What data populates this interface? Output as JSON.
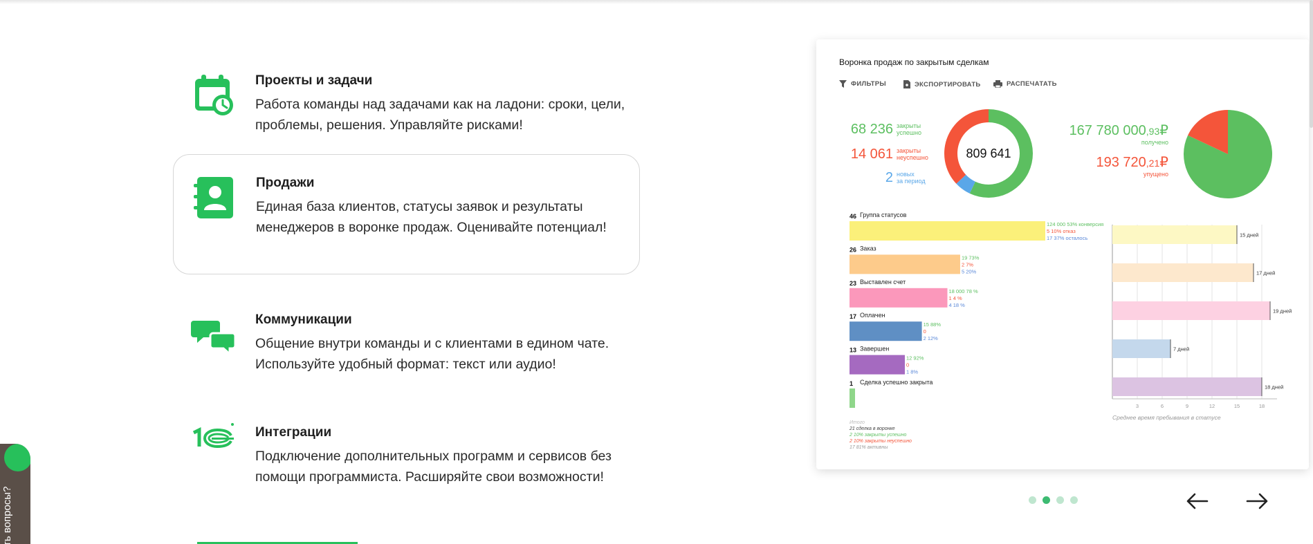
{
  "features": [
    {
      "title": "Проекты и задачи",
      "desc": "Работа команды над задачами как на ладони: сроки, цели, проблемы, решения. Управляйте рисками!",
      "icon": "calendar-clock-icon"
    },
    {
      "title": "Продажи",
      "desc": "Единая база клиентов, статусы заявок и результаты менеджеров в воронке продаж. Оценивайте потенциал!",
      "icon": "contact-book-icon"
    },
    {
      "title": "Коммуникации",
      "desc": "Общение внутри команды и с клиентами в едином чате. Используйте удобный формат: текст или аудио!",
      "icon": "chat-bubbles-icon"
    },
    {
      "title": "Интеграции",
      "desc": "Подключение дополнительных программ и сервисов без помощи программиста. Расширяйте свои возможности!",
      "icon": "1c-logo-icon"
    }
  ],
  "panel": {
    "title": "Воронка продаж по закрытым сделкам",
    "tools": [
      "ФИЛЬТРЫ",
      "ЭКСПОРТИРОВАТЬ",
      "РАСПЕЧАТАТЬ"
    ]
  },
  "help": {
    "label": "ть вопросы?"
  },
  "colors": {
    "accent": "#27c05b",
    "green": "#5cbf60",
    "red": "#f4553a",
    "blue": "#5aa7e8",
    "dot": "#bfe6cf",
    "dot_active": "#3dbb72"
  },
  "chart_data": [
    {
      "type": "pie",
      "title": "",
      "center_label": "809 641",
      "legend": [
        {
          "value": "68 236",
          "label1": "закрыты",
          "label2": "успешно",
          "color": "#5cbf60"
        },
        {
          "value": "14 061",
          "label1": "закрыты",
          "label2": "неуспешно",
          "color": "#f4553a"
        },
        {
          "value": "2",
          "label1": "новых",
          "label2": "за период",
          "color": "#5aa7e8"
        }
      ],
      "slices": [
        {
          "name": "закрыты успешно",
          "value": 0.57,
          "color": "#5cbf60"
        },
        {
          "name": "новых",
          "value": 0.06,
          "color": "#5aa7e8"
        },
        {
          "name": "закрыты неуспешно",
          "value": 0.37,
          "color": "#f4553a"
        }
      ]
    },
    {
      "type": "pie",
      "title": "",
      "legend": [
        {
          "value": "167 780 000",
          "cents": ",93",
          "currency": "₽",
          "label": "получено",
          "color": "#5cbf60"
        },
        {
          "value": "193 720",
          "cents": ",21",
          "currency": "₽",
          "label": "упущено",
          "color": "#f4553a"
        }
      ],
      "slices": [
        {
          "name": "получено",
          "value": 0.82,
          "color": "#5cbf60"
        },
        {
          "name": "упущено",
          "value": 0.18,
          "color": "#f4553a"
        }
      ]
    },
    {
      "type": "bar",
      "title": "",
      "categories": [
        "Группа статусов",
        "Заказ",
        "Выставлен счет",
        "Оплачен",
        "Завершен",
        "Сделка успешно закрыта"
      ],
      "counts": [
        "46",
        "26",
        "23",
        "17",
        "13",
        "1"
      ],
      "values": [
        46,
        26,
        23,
        17,
        13,
        1
      ],
      "colors": [
        "#fbf07a",
        "#fdcb8b",
        "#fb98bb",
        "#5f8fc4",
        "#a56ac0",
        "#8fd68a"
      ],
      "annotations": [
        [
          {
            "t": "124 000 53% конверсия",
            "c": "#5cbf60"
          },
          {
            "t": "5 10% отказ",
            "c": "#f4553a"
          },
          {
            "t": "17 37% осталось",
            "c": "#5a88d8"
          }
        ],
        [
          {
            "t": "19 73%",
            "c": "#5cbf60"
          },
          {
            "t": "2 7%",
            "c": "#f4553a"
          },
          {
            "t": "5 20%",
            "c": "#5a88d8"
          }
        ],
        [
          {
            "t": "18 000 78 %",
            "c": "#5cbf60"
          },
          {
            "t": "1 4 %",
            "c": "#f4553a"
          },
          {
            "t": "4 18 %",
            "c": "#5a88d8"
          }
        ],
        [
          {
            "t": "15 88%",
            "c": "#5cbf60"
          },
          {
            "t": "0",
            "c": "#f4553a"
          },
          {
            "t": "2 12%",
            "c": "#5a88d8"
          }
        ],
        [
          {
            "t": "12 92%",
            "c": "#5cbf60"
          },
          {
            "t": "0",
            "c": "#f4553a"
          },
          {
            "t": "1 8%",
            "c": "#5a88d8"
          }
        ],
        []
      ],
      "summary": [
        {
          "t": "Итого",
          "c": "#bbbbbb"
        },
        {
          "t": "21 сделка в воронке",
          "c": "#444444"
        },
        {
          "t": "2 10% закрыты успешно",
          "c": "#5cbf60"
        },
        {
          "t": "2 10% закрыты неуспешно",
          "c": "#f4553a"
        },
        {
          "t": "17 81% активны",
          "c": "#999999"
        }
      ]
    },
    {
      "type": "bar",
      "title": "",
      "xlabel": "Среднее время пребывания в статусе",
      "values": [
        15,
        17,
        19,
        7,
        18
      ],
      "labels": [
        "15 дней",
        "17 дней",
        "19 дней",
        "7 дней",
        "18 дней"
      ],
      "colors": [
        "#fdf8c4",
        "#fde8cd",
        "#fdd1e2",
        "#c4d8ec",
        "#dcc3e2"
      ],
      "xticks": [
        "3",
        "6",
        "9",
        "12",
        "15",
        "18"
      ],
      "xlim": [
        0,
        19
      ]
    }
  ]
}
